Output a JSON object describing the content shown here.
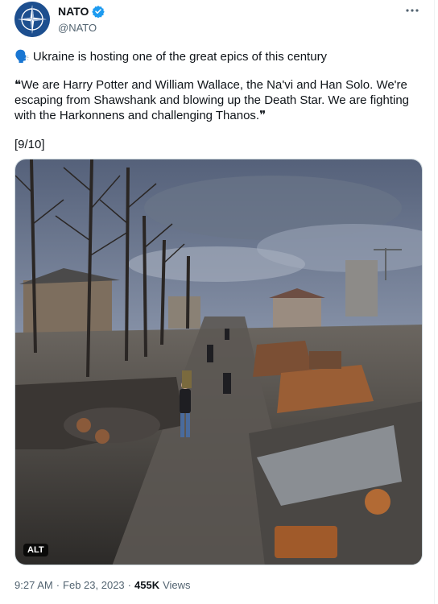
{
  "account": {
    "name": "NATO",
    "handle": "@NATO",
    "verified_icon": "verified-badge-icon",
    "avatar_icon": "nato-compass-star-logo"
  },
  "tweet": {
    "line1_emoji": "🗣️",
    "line1_text": "Ukraine is hosting one of the great epics of this century",
    "quote_lines": [
      "❝We are Harry Potter and William Wallace, the Na'vi and Han Solo. We're",
      "escaping from Shawshank and blowing up the Death Star. We are fighting",
      "with the Harkonnens and challenging Thanos.❞"
    ],
    "counter": "[9/10]"
  },
  "media": {
    "alt_label": "ALT",
    "description_icon": "war-damaged-street-photo"
  },
  "meta": {
    "time": "9:27 AM",
    "separator": "·",
    "date": "Feb 23, 2023",
    "views_count": "455K",
    "views_label": "Views"
  },
  "colors": {
    "text": "#0f1419",
    "secondary": "#536471",
    "verified": "#1d9bf0",
    "nato_blue": "#1d4f8f"
  },
  "more_icon": "more-dots-icon"
}
